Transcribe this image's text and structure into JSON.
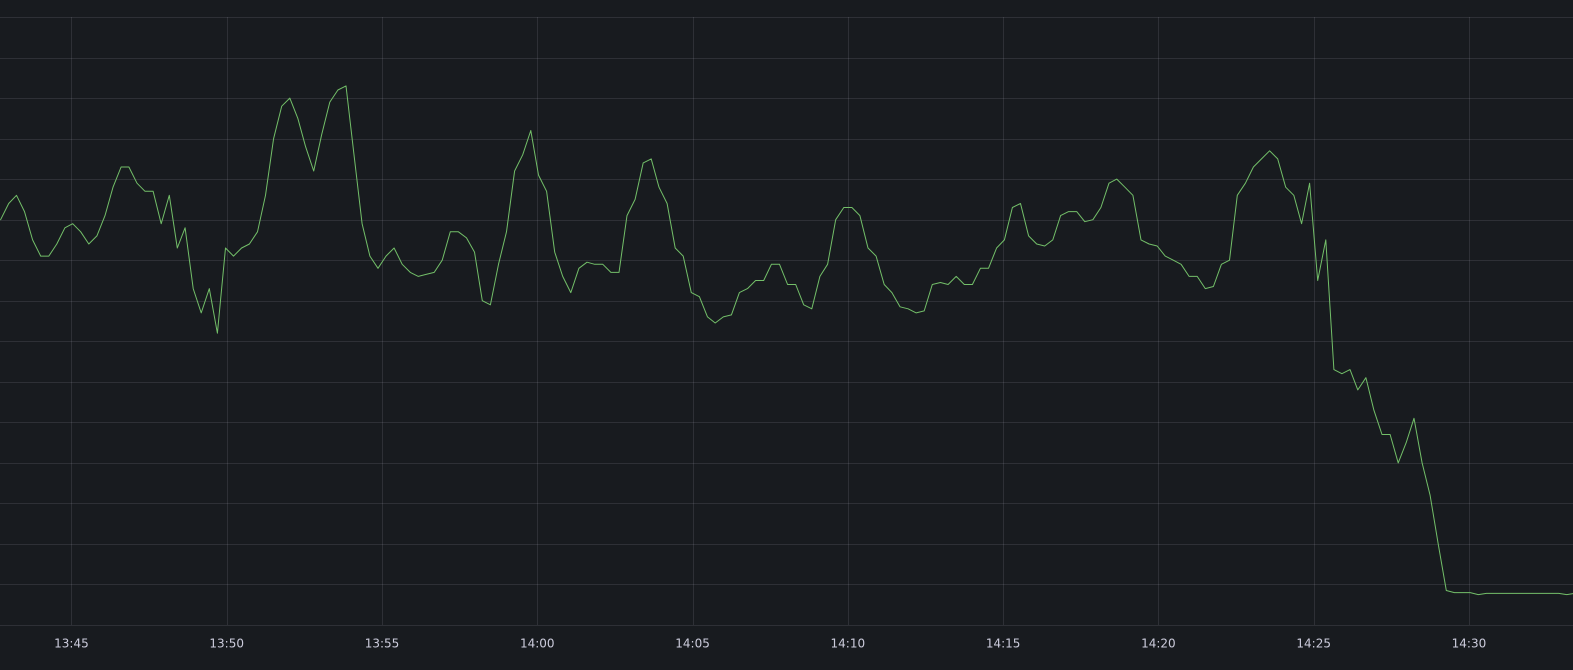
{
  "chart_data": {
    "type": "line",
    "title": "",
    "xlabel": "",
    "ylabel": "",
    "grid": true,
    "colors": {
      "background": "#181b1f",
      "series": "#73bf69",
      "grid": "rgba(204, 204, 220, 0.12)",
      "tick_text": "#ccccdc"
    },
    "x_tick_labels": [
      "13:45",
      "13:50",
      "13:55",
      "14:00",
      "14:05",
      "14:10",
      "14:15",
      "14:20",
      "14:25",
      "14:30"
    ],
    "x_ticks_minutes": [
      45,
      50,
      55,
      60,
      65,
      70,
      75,
      80,
      85,
      90
    ],
    "xlim_minutes": [
      42.7,
      93.35
    ],
    "ylim": [
      0,
      15
    ],
    "y_grid_step": 1,
    "series": [
      {
        "values": [
          [
            42.72,
            10.0
          ],
          [
            42.98,
            10.4
          ],
          [
            43.23,
            10.6
          ],
          [
            43.49,
            10.2
          ],
          [
            43.75,
            9.5
          ],
          [
            44.01,
            9.1
          ],
          [
            44.27,
            9.1
          ],
          [
            44.53,
            9.4
          ],
          [
            44.79,
            9.8
          ],
          [
            45.04,
            9.9
          ],
          [
            45.3,
            9.7
          ],
          [
            45.56,
            9.4
          ],
          [
            45.82,
            9.6
          ],
          [
            46.08,
            10.1
          ],
          [
            46.34,
            10.8
          ],
          [
            46.6,
            11.3
          ],
          [
            46.85,
            11.3
          ],
          [
            47.11,
            10.9
          ],
          [
            47.37,
            10.7
          ],
          [
            47.63,
            10.7
          ],
          [
            47.89,
            9.9
          ],
          [
            48.15,
            10.6
          ],
          [
            48.41,
            9.3
          ],
          [
            48.66,
            9.8
          ],
          [
            48.92,
            8.3
          ],
          [
            49.18,
            7.7
          ],
          [
            49.44,
            8.3
          ],
          [
            49.7,
            7.2
          ],
          [
            49.96,
            9.3
          ],
          [
            50.22,
            9.1
          ],
          [
            50.48,
            9.3
          ],
          [
            50.73,
            9.4
          ],
          [
            50.99,
            9.7
          ],
          [
            51.25,
            10.6
          ],
          [
            51.51,
            12.0
          ],
          [
            51.77,
            12.8
          ],
          [
            52.03,
            13.0
          ],
          [
            52.29,
            12.5
          ],
          [
            52.54,
            11.8
          ],
          [
            52.8,
            11.2
          ],
          [
            53.06,
            12.1
          ],
          [
            53.32,
            12.9
          ],
          [
            53.58,
            13.2
          ],
          [
            53.84,
            13.3
          ],
          [
            54.1,
            11.6
          ],
          [
            54.36,
            9.9
          ],
          [
            54.61,
            9.1
          ],
          [
            54.87,
            8.8
          ],
          [
            55.13,
            9.1
          ],
          [
            55.39,
            9.3
          ],
          [
            55.65,
            8.9
          ],
          [
            55.91,
            8.7
          ],
          [
            56.17,
            8.6
          ],
          [
            56.42,
            8.65
          ],
          [
            56.68,
            8.7
          ],
          [
            56.94,
            9.0
          ],
          [
            57.2,
            9.7
          ],
          [
            57.46,
            9.7
          ],
          [
            57.72,
            9.55
          ],
          [
            57.98,
            9.2
          ],
          [
            58.23,
            8.0
          ],
          [
            58.49,
            7.9
          ],
          [
            58.75,
            8.9
          ],
          [
            59.01,
            9.7
          ],
          [
            59.27,
            11.2
          ],
          [
            59.53,
            11.6
          ],
          [
            59.79,
            12.2
          ],
          [
            60.04,
            11.1
          ],
          [
            60.3,
            10.7
          ],
          [
            60.56,
            9.2
          ],
          [
            60.82,
            8.6
          ],
          [
            61.08,
            8.2
          ],
          [
            61.34,
            8.8
          ],
          [
            61.6,
            8.95
          ],
          [
            61.85,
            8.9
          ],
          [
            62.11,
            8.9
          ],
          [
            62.37,
            8.7
          ],
          [
            62.63,
            8.7
          ],
          [
            62.89,
            10.1
          ],
          [
            63.15,
            10.5
          ],
          [
            63.41,
            11.4
          ],
          [
            63.67,
            11.5
          ],
          [
            63.92,
            10.8
          ],
          [
            64.18,
            10.4
          ],
          [
            64.44,
            9.3
          ],
          [
            64.7,
            9.1
          ],
          [
            64.96,
            8.2
          ],
          [
            65.22,
            8.1
          ],
          [
            65.48,
            7.6
          ],
          [
            65.73,
            7.45
          ],
          [
            65.99,
            7.6
          ],
          [
            66.25,
            7.65
          ],
          [
            66.51,
            8.2
          ],
          [
            66.77,
            8.3
          ],
          [
            67.03,
            8.5
          ],
          [
            67.29,
            8.5
          ],
          [
            67.54,
            8.9
          ],
          [
            67.8,
            8.9
          ],
          [
            68.06,
            8.4
          ],
          [
            68.32,
            8.4
          ],
          [
            68.58,
            7.9
          ],
          [
            68.84,
            7.8
          ],
          [
            69.1,
            8.6
          ],
          [
            69.35,
            8.9
          ],
          [
            69.61,
            10.0
          ],
          [
            69.87,
            10.3
          ],
          [
            70.13,
            10.3
          ],
          [
            70.39,
            10.1
          ],
          [
            70.65,
            9.3
          ],
          [
            70.91,
            9.1
          ],
          [
            71.17,
            8.4
          ],
          [
            71.42,
            8.2
          ],
          [
            71.68,
            7.85
          ],
          [
            71.94,
            7.8
          ],
          [
            72.2,
            7.7
          ],
          [
            72.46,
            7.75
          ],
          [
            72.72,
            8.4
          ],
          [
            72.98,
            8.45
          ],
          [
            73.23,
            8.4
          ],
          [
            73.49,
            8.6
          ],
          [
            73.75,
            8.4
          ],
          [
            74.01,
            8.4
          ],
          [
            74.27,
            8.8
          ],
          [
            74.53,
            8.8
          ],
          [
            74.79,
            9.3
          ],
          [
            75.04,
            9.5
          ],
          [
            75.3,
            10.3
          ],
          [
            75.56,
            10.4
          ],
          [
            75.82,
            9.6
          ],
          [
            76.08,
            9.4
          ],
          [
            76.34,
            9.35
          ],
          [
            76.6,
            9.5
          ],
          [
            76.85,
            10.1
          ],
          [
            77.11,
            10.2
          ],
          [
            77.37,
            10.2
          ],
          [
            77.63,
            9.95
          ],
          [
            77.89,
            10.0
          ],
          [
            78.15,
            10.3
          ],
          [
            78.41,
            10.9
          ],
          [
            78.66,
            11.0
          ],
          [
            78.92,
            10.8
          ],
          [
            79.18,
            10.6
          ],
          [
            79.44,
            9.5
          ],
          [
            79.7,
            9.4
          ],
          [
            79.96,
            9.35
          ],
          [
            80.22,
            9.1
          ],
          [
            80.48,
            9.0
          ],
          [
            80.73,
            8.9
          ],
          [
            80.99,
            8.6
          ],
          [
            81.25,
            8.6
          ],
          [
            81.51,
            8.3
          ],
          [
            81.77,
            8.35
          ],
          [
            82.03,
            8.9
          ],
          [
            82.29,
            9.0
          ],
          [
            82.54,
            10.6
          ],
          [
            82.8,
            10.9
          ],
          [
            83.06,
            11.3
          ],
          [
            83.32,
            11.5
          ],
          [
            83.58,
            11.7
          ],
          [
            83.84,
            11.5
          ],
          [
            84.1,
            10.8
          ],
          [
            84.36,
            10.6
          ],
          [
            84.61,
            9.9
          ],
          [
            84.87,
            10.9
          ],
          [
            85.13,
            8.5
          ],
          [
            85.39,
            9.5
          ],
          [
            85.65,
            6.3
          ],
          [
            85.91,
            6.2
          ],
          [
            86.17,
            6.3
          ],
          [
            86.42,
            5.8
          ],
          [
            86.68,
            6.1
          ],
          [
            86.94,
            5.3
          ],
          [
            87.2,
            4.7
          ],
          [
            87.46,
            4.7
          ],
          [
            87.72,
            4.0
          ],
          [
            87.98,
            4.5
          ],
          [
            88.23,
            5.1
          ],
          [
            88.49,
            4.0
          ],
          [
            88.75,
            3.2
          ],
          [
            89.01,
            2.0
          ],
          [
            89.27,
            0.85
          ],
          [
            89.53,
            0.8
          ],
          [
            89.79,
            0.8
          ],
          [
            90.04,
            0.8
          ],
          [
            90.3,
            0.75
          ],
          [
            90.56,
            0.78
          ],
          [
            90.82,
            0.78
          ],
          [
            91.08,
            0.78
          ],
          [
            91.34,
            0.78
          ],
          [
            91.6,
            0.78
          ],
          [
            91.85,
            0.78
          ],
          [
            92.11,
            0.78
          ],
          [
            92.37,
            0.78
          ],
          [
            92.63,
            0.78
          ],
          [
            92.89,
            0.78
          ],
          [
            93.15,
            0.75
          ],
          [
            93.41,
            0.78
          ],
          [
            93.67,
            0.78
          ],
          [
            93.93,
            0.78
          ]
        ]
      }
    ]
  }
}
